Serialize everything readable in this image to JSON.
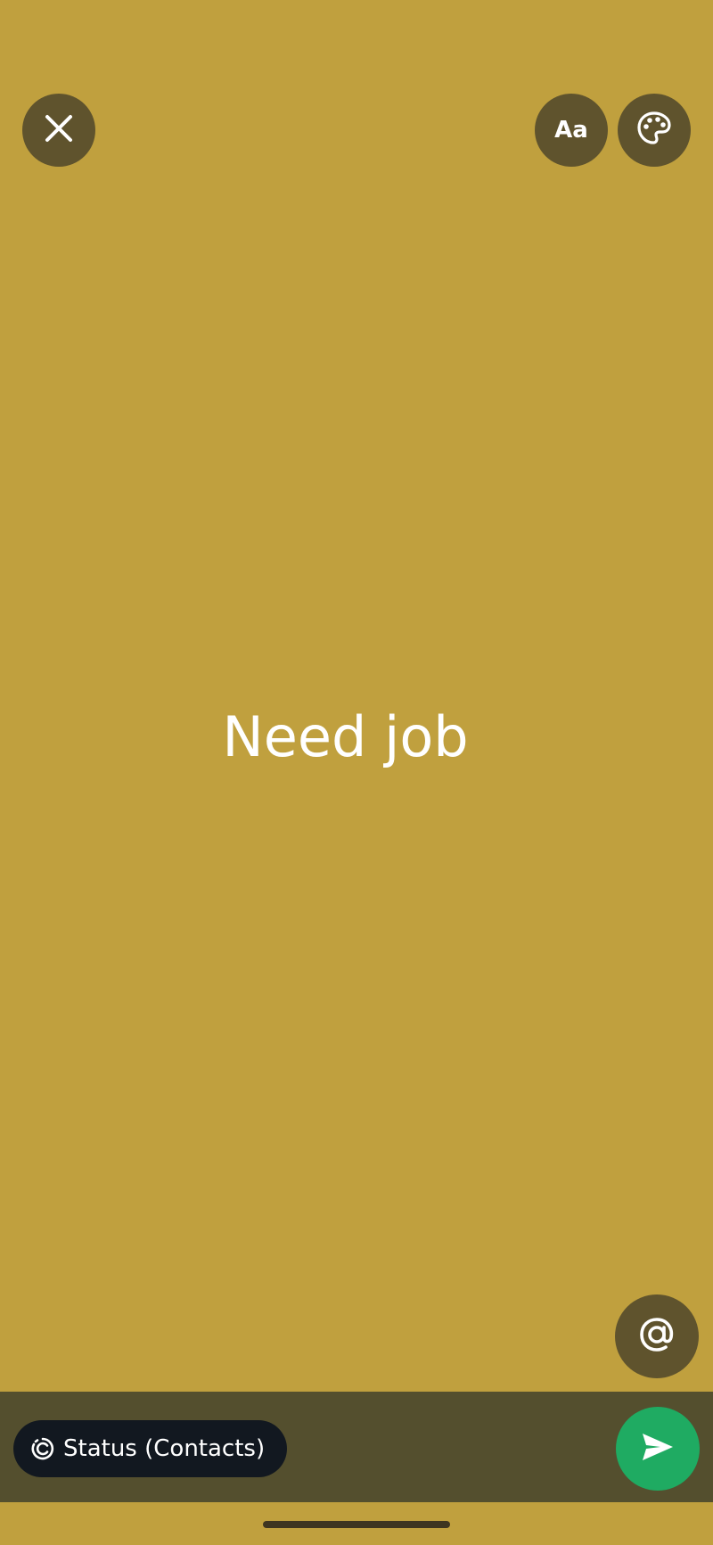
{
  "status": {
    "text": "Need job",
    "background_color": "#c0a03e"
  },
  "toolbar": {
    "close_icon": "close-icon",
    "font_label": "Aa",
    "palette_icon": "palette-icon"
  },
  "mention_icon": "at-icon",
  "bottom_bar": {
    "audience_label": "Status (Contacts)",
    "audience_icon": "status-ring-icon",
    "send_icon": "send-icon",
    "send_color": "#1fab62"
  }
}
